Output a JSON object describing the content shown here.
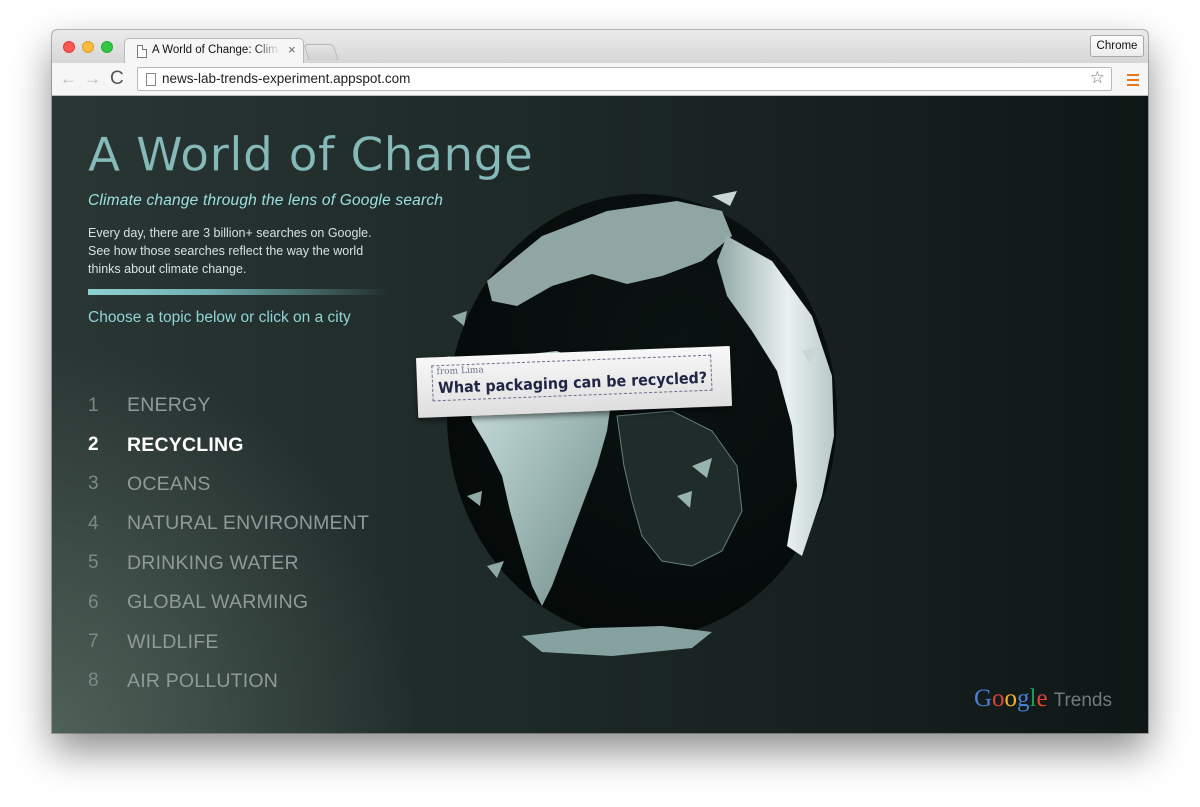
{
  "browser": {
    "tab_title": "A World of Change: Climate",
    "tab_close": "×",
    "profile_label": "Chrome",
    "url": "news-lab-trends-experiment.appspot.com",
    "back_glyph": "←",
    "forward_glyph": "→",
    "reload_glyph": "C",
    "star_glyph": "☆"
  },
  "page": {
    "title": "A World of Change",
    "subtitle": "Climate change through the lens of Google search",
    "intro": "Every day, there are 3 billion+ searches on Google. See how those searches reflect the way the world thinks about climate change.",
    "prompt": "Choose a topic below or click on a city",
    "topics": [
      {
        "num": "1",
        "label": "ENERGY"
      },
      {
        "num": "2",
        "label": "RECYCLING"
      },
      {
        "num": "3",
        "label": "OCEANS"
      },
      {
        "num": "4",
        "label": "NATURAL ENVIRONMENT"
      },
      {
        "num": "5",
        "label": "DRINKING WATER"
      },
      {
        "num": "6",
        "label": "GLOBAL WARMING"
      },
      {
        "num": "7",
        "label": "WILDLIFE"
      },
      {
        "num": "8",
        "label": "AIR POLLUTION"
      }
    ],
    "active_topic": "RECYCLING"
  },
  "search_card": {
    "from": "from Lima",
    "query": "What packaging can be recycled?"
  },
  "branding": {
    "google_letters": [
      "G",
      "o",
      "o",
      "g",
      "l",
      "e"
    ],
    "product": "Trends"
  },
  "colors": {
    "accent": "#8fd4d6",
    "active_topic": "#ffffff",
    "topic_text": "#8e9b98"
  }
}
